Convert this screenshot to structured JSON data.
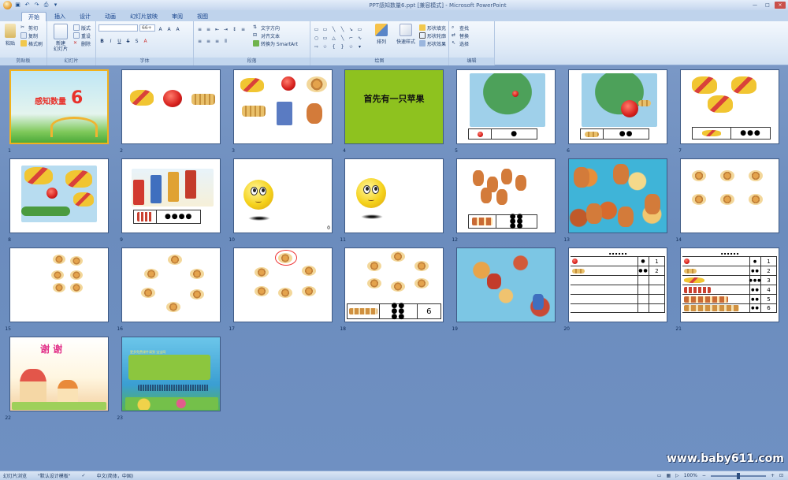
{
  "window": {
    "title": "PPT感知数量6.ppt [兼容模式] - Microsoft PowerPoint",
    "controls": [
      "—",
      "□",
      "×"
    ]
  },
  "tabs": [
    "开始",
    "插入",
    "设计",
    "动画",
    "幻灯片放映",
    "审阅",
    "视图"
  ],
  "ribbon": {
    "clipboard": {
      "name": "剪贴板",
      "paste": "粘贴",
      "cut": "剪切",
      "copy": "复制",
      "format_painter": "格式刷"
    },
    "slides": {
      "name": "幻灯片",
      "new_slide": "新建\n幻灯片",
      "layout": "版式",
      "reset": "重设",
      "delete": "删除"
    },
    "font": {
      "name": "字体",
      "font_name": "",
      "font_size": "66+",
      "bold": "B",
      "italic": "I",
      "underline": "U",
      "strike": "S",
      "shadow": "S",
      "grow": "A",
      "shrink": "A",
      "clear": "A",
      "color": "A"
    },
    "paragraph": {
      "name": "段落",
      "text_direction": "文字方向",
      "align_text": "对齐文本",
      "smartart": "转换为 SmartArt"
    },
    "drawing": {
      "name": "绘图",
      "arrange": "排列",
      "quick_styles": "快速样式",
      "shape_fill": "形状填充",
      "shape_outline": "形状轮廓",
      "shape_effects": "形状效果"
    },
    "editing": {
      "name": "编辑",
      "find": "查找",
      "replace": "替换",
      "select": "选择"
    }
  },
  "slides": [
    {
      "n": "1",
      "title": "感知数量",
      "big": "6"
    },
    {
      "n": "2"
    },
    {
      "n": "3"
    },
    {
      "n": "4",
      "text": "首先有一只苹果"
    },
    {
      "n": "5"
    },
    {
      "n": "6"
    },
    {
      "n": "7"
    },
    {
      "n": "8"
    },
    {
      "n": "9"
    },
    {
      "n": "10",
      "extra": "0"
    },
    {
      "n": "11"
    },
    {
      "n": "12"
    },
    {
      "n": "13"
    },
    {
      "n": "14"
    },
    {
      "n": "15"
    },
    {
      "n": "16"
    },
    {
      "n": "17"
    },
    {
      "n": "18",
      "count": "6"
    },
    {
      "n": "19"
    },
    {
      "n": "20",
      "rows": [
        "1",
        "2"
      ]
    },
    {
      "n": "21",
      "rows": [
        "1",
        "2",
        "3",
        "4",
        "5",
        "6"
      ]
    },
    {
      "n": "22",
      "text": "谢 谢"
    },
    {
      "n": "23",
      "text": "更多免费课件请到 宝宝网"
    }
  ],
  "status": {
    "view": "幻灯片浏览",
    "theme": "\"默认设计模板\"",
    "language": "中文(简体，中国)",
    "zoom": "100%",
    "zoom_fraction": 0.5
  },
  "watermark": "www.baby611.com",
  "colors": {
    "slide4_bg": "#8ec21f",
    "selection": "#f2b21c",
    "sorter_bg": "#6c8cbd"
  }
}
